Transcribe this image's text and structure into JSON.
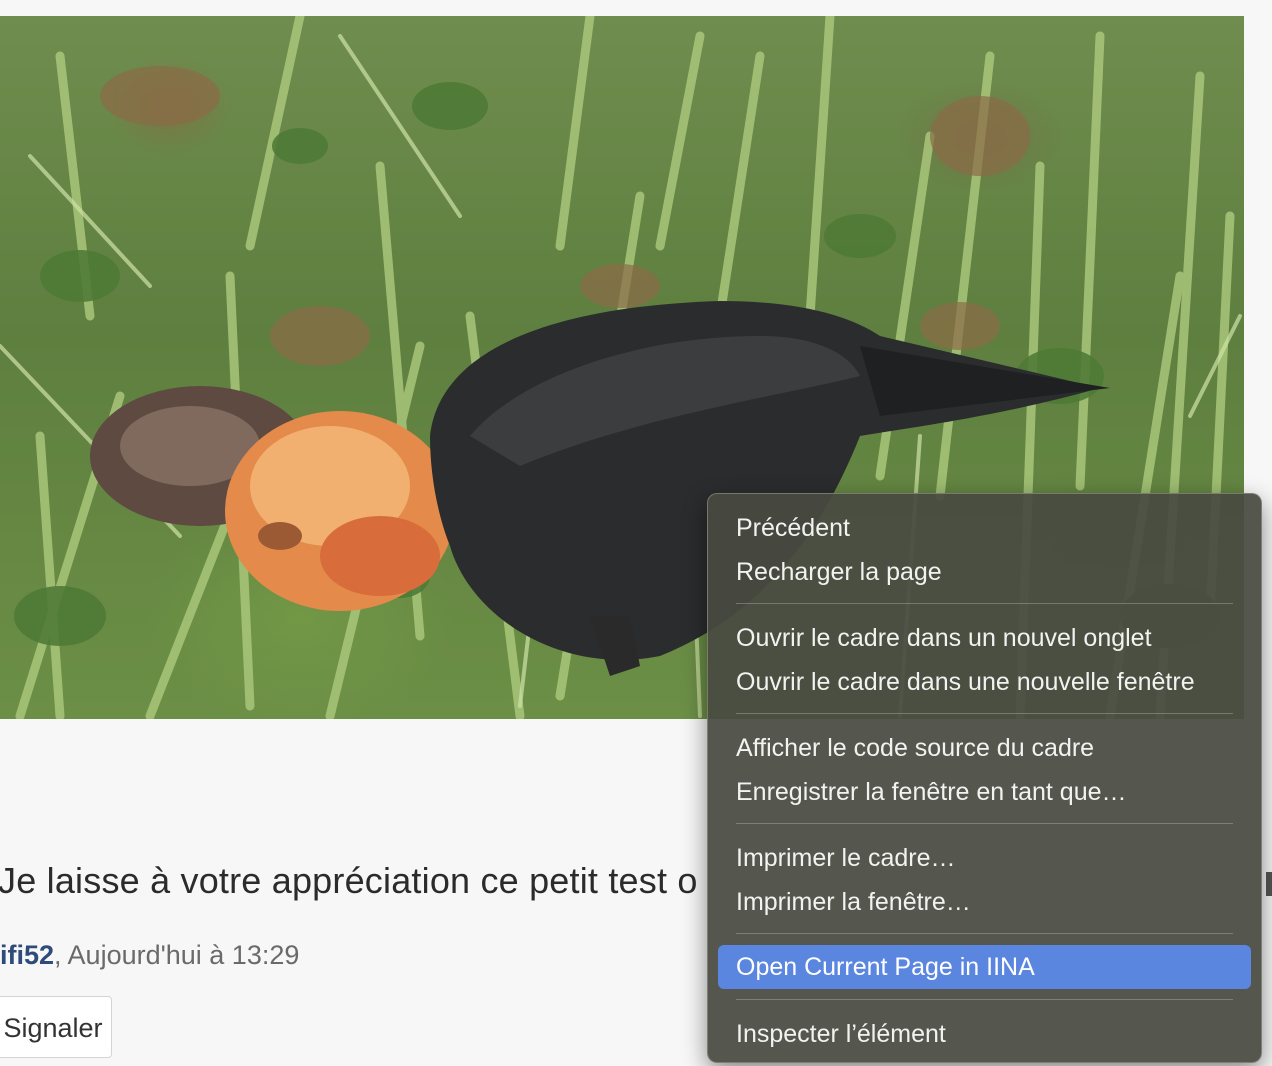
{
  "post": {
    "text": "Je laisse à votre appréciation ce petit test o",
    "author": "ifi52",
    "timestamp": ", Aujourd'hui à 13:29",
    "report_label": "Signaler"
  },
  "context_menu": {
    "items": [
      {
        "label": "Précédent"
      },
      {
        "label": "Recharger la page"
      },
      {
        "label": "Ouvrir le cadre dans un nouvel onglet"
      },
      {
        "label": "Ouvrir le cadre dans une nouvelle fenêtre"
      },
      {
        "label": "Afficher le code source du cadre"
      },
      {
        "label": "Enregistrer la fenêtre en tant que…"
      },
      {
        "label": "Imprimer le cadre…"
      },
      {
        "label": "Imprimer la fenêtre…"
      },
      {
        "label": "Open Current Page in IINA",
        "highlighted": true
      },
      {
        "label": "Inspecter l’élément"
      }
    ]
  },
  "colors": {
    "highlight": "#5b86e0",
    "menu_background": "#484a42",
    "username": "#2f4b7a"
  }
}
